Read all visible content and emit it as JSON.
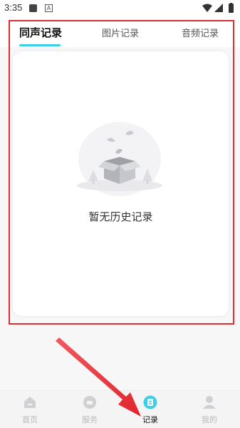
{
  "status_bar": {
    "time": "3:35",
    "icons": [
      "notification-icon",
      "a-icon",
      "wifi-icon",
      "signal-icon",
      "battery-icon"
    ]
  },
  "tabs": [
    {
      "label": "同声记录",
      "active": true
    },
    {
      "label": "图片记录",
      "active": false
    },
    {
      "label": "音频记录",
      "active": false
    }
  ],
  "empty_state": {
    "message": "暂无历史记录",
    "icon": "empty-box-illustration"
  },
  "bottom_nav": [
    {
      "label": "首页",
      "icon": "home-icon",
      "active": false
    },
    {
      "label": "服务",
      "icon": "service-icon",
      "active": false
    },
    {
      "label": "记录",
      "icon": "record-icon",
      "active": true
    },
    {
      "label": "我的",
      "icon": "profile-icon",
      "active": false
    }
  ],
  "colors": {
    "accent": "#3bd0e8",
    "annotation": "#e02c33",
    "inactive_nav": "#b9b9b9"
  }
}
